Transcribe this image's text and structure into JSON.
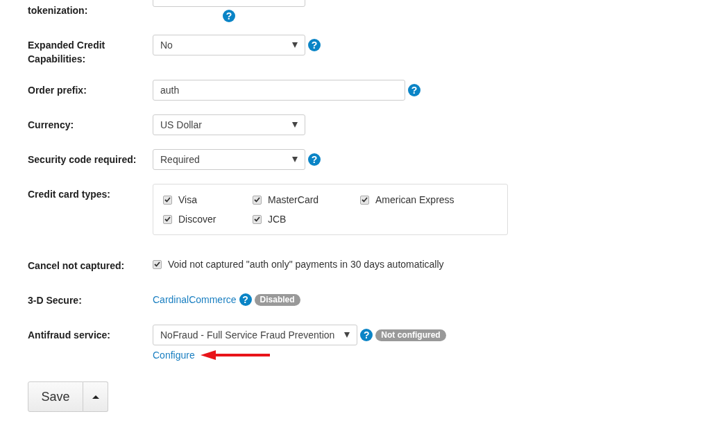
{
  "rows": [
    {
      "kind": "cut",
      "label": "tokenization:",
      "help": "?"
    },
    {
      "kind": "select",
      "label": "Expanded Credit Capabilities:",
      "value": "No",
      "help": "?"
    },
    {
      "kind": "text",
      "label": "Order prefix:",
      "value": "auth",
      "help": "?"
    },
    {
      "kind": "select",
      "label": "Currency:",
      "value": "US Dollar"
    },
    {
      "kind": "select",
      "label": "Security code required:",
      "value": "Required",
      "help": "?"
    },
    {
      "kind": "checkgroup",
      "label": "Credit card types:",
      "options": [
        {
          "label": "Visa",
          "checked": true
        },
        {
          "label": "MasterCard",
          "checked": true
        },
        {
          "label": "American Express",
          "checked": true
        },
        {
          "label": "Discover",
          "checked": true
        },
        {
          "label": "JCB",
          "checked": true
        }
      ]
    },
    {
      "kind": "checkbox",
      "label": "Cancel not captured:",
      "text": "Void not captured \"auth only\" payments in 30 days automatically",
      "checked": true
    },
    {
      "kind": "link",
      "label": "3-D Secure:",
      "link": "CardinalCommerce",
      "help": "?",
      "badge": "Disabled"
    },
    {
      "kind": "select",
      "label": "Antifraud service:",
      "value": "NoFraud - Full Service Fraud Prevention",
      "help": "?",
      "badge": "Not configured",
      "link": "Configure",
      "arrow": true
    }
  ],
  "save": {
    "label": "Save"
  }
}
